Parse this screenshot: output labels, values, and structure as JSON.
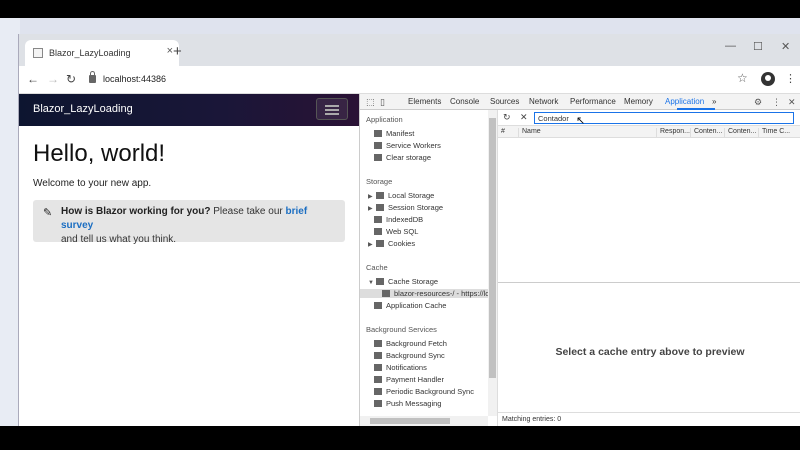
{
  "browser": {
    "tab_title": "Blazor_LazyLoading",
    "tab_close": "×",
    "new_tab": "+",
    "url": "localhost:44386",
    "back": "←",
    "forward": "→",
    "reload": "↻",
    "star": "☆",
    "menu": "⋮",
    "minimize": "—",
    "maximize": "☐",
    "close": "✕"
  },
  "app": {
    "brand": "Blazor_LazyLoading",
    "heading": "Hello, world!",
    "welcome": "Welcome to your new app.",
    "alert_icon": "✎",
    "alert_question": "How is Blazor working for you?",
    "alert_text_1": " Please take our ",
    "alert_link": "brief survey",
    "alert_text_2": "and tell us what you think."
  },
  "devtools": {
    "tabs": [
      "Elements",
      "Console",
      "Sources",
      "Network",
      "Performance",
      "Memory",
      "Application"
    ],
    "active_tab": "Application",
    "more_tabs": "»",
    "settings": "⚙",
    "menu": "⋮",
    "close": "✕",
    "sidebar": {
      "application_header": "Application",
      "application_items": [
        "Manifest",
        "Service Workers",
        "Clear storage"
      ],
      "storage_header": "Storage",
      "storage_items": [
        "Local Storage",
        "Session Storage",
        "IndexedDB",
        "Web SQL",
        "Cookies"
      ],
      "cache_header": "Cache",
      "cache_items": [
        "Cache Storage",
        "blazor-resources-/ - https://lo",
        "Application Cache"
      ],
      "background_header": "Background Services",
      "background_items": [
        "Background Fetch",
        "Background Sync",
        "Notifications",
        "Payment Handler",
        "Periodic Background Sync",
        "Push Messaging"
      ]
    },
    "main": {
      "filter_value": "Contador",
      "columns": [
        "#",
        "Name",
        "Respon...",
        "Conten...",
        "Conten...",
        "Time C..."
      ],
      "preview_message": "Select a cache entry above to preview",
      "matching": "Matching entries: 0"
    }
  }
}
